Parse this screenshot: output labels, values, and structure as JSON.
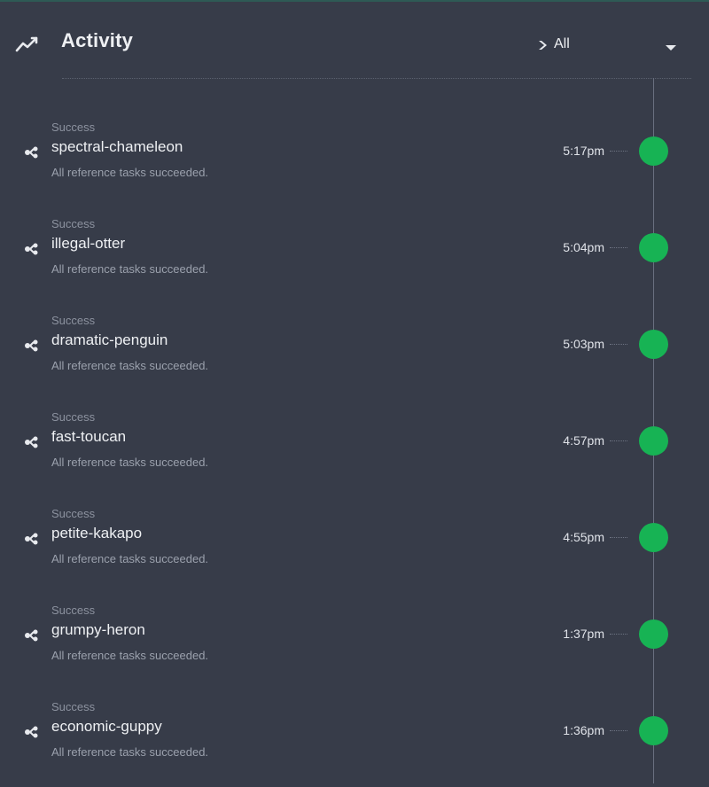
{
  "header": {
    "title": "Activity",
    "icon": "trending-line-icon",
    "filter": {
      "value": "All",
      "icon": "chevron-right-icon",
      "caret": "caret-down-icon"
    }
  },
  "colors": {
    "background": "#373c49",
    "success": "#17b354",
    "timeline": "#6a7080"
  },
  "items": [
    {
      "status": "Success",
      "name": "spectral-chameleon",
      "description": "All reference tasks succeeded.",
      "time": "5:17pm",
      "icon": "flow-icon"
    },
    {
      "status": "Success",
      "name": "illegal-otter",
      "description": "All reference tasks succeeded.",
      "time": "5:04pm",
      "icon": "flow-icon"
    },
    {
      "status": "Success",
      "name": "dramatic-penguin",
      "description": "All reference tasks succeeded.",
      "time": "5:03pm",
      "icon": "flow-icon"
    },
    {
      "status": "Success",
      "name": "fast-toucan",
      "description": "All reference tasks succeeded.",
      "time": "4:57pm",
      "icon": "flow-icon"
    },
    {
      "status": "Success",
      "name": "petite-kakapo",
      "description": "All reference tasks succeeded.",
      "time": "4:55pm",
      "icon": "flow-icon"
    },
    {
      "status": "Success",
      "name": "grumpy-heron",
      "description": "All reference tasks succeeded.",
      "time": "1:37pm",
      "icon": "flow-icon"
    },
    {
      "status": "Success",
      "name": "economic-guppy",
      "description": "All reference tasks succeeded.",
      "time": "1:36pm",
      "icon": "flow-icon"
    }
  ]
}
